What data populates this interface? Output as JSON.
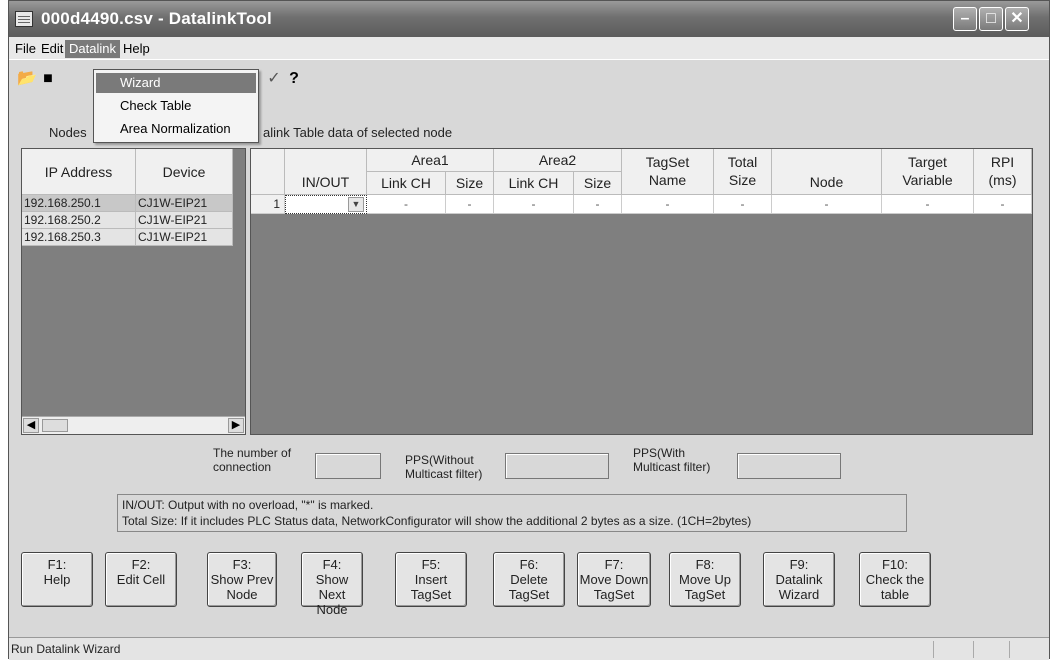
{
  "window": {
    "title": "000d4490.csv - DatalinkTool"
  },
  "menu": [
    "File",
    "Edit",
    "Datalink",
    "Help"
  ],
  "datalink_menu": [
    "Wizard",
    "Check Table",
    "Area Normalization"
  ],
  "labels": {
    "nodes": "Nodes",
    "table_caption": "alink Table data of selected node"
  },
  "nodes": {
    "headers": [
      "IP Address",
      "Device"
    ],
    "rows": [
      [
        "192.168.250.1",
        "CJ1W-EIP21"
      ],
      [
        "192.168.250.2",
        "CJ1W-EIP21"
      ],
      [
        "192.168.250.3",
        "CJ1W-EIP21"
      ]
    ]
  },
  "table": {
    "headers": {
      "inout": "IN/OUT",
      "area1": "Area1",
      "area2": "Area2",
      "link_ch": "Link CH",
      "size": "Size",
      "tagset_name": "TagSet Name",
      "total_size": "Total Size",
      "node": "Node",
      "target_variable": "Target Variable",
      "rpi": "RPI (ms)"
    },
    "row": {
      "num": "1",
      "cells": [
        "-",
        "-",
        "-",
        "-",
        "-",
        "-",
        "-",
        "-",
        "-"
      ]
    }
  },
  "stats": {
    "connections": "The number of connection",
    "pps_without": "PPS(Without Multicast filter)",
    "pps_with": "PPS(With Multicast filter)"
  },
  "notes": {
    "line1": "IN/OUT: Output with no overload, \"*\" is marked.",
    "line2": "Total Size: If it includes PLC Status data, NetworkConfigurator will show the additional 2 bytes as a size. (1CH=2bytes)"
  },
  "fkeys": [
    "F1:\nHelp",
    "F2:\nEdit Cell",
    "F3:\nShow Prev\nNode",
    "F4:\nShow Next\nNode",
    "F5:\nInsert\nTagSet",
    "F6:\nDelete\nTagSet",
    "F7:\nMove Down\nTagSet",
    "F8:\nMove Up\nTagSet",
    "F9:\nDatalink\nWizard",
    "F10:\nCheck the\ntable"
  ],
  "status": "Run Datalink Wizard"
}
